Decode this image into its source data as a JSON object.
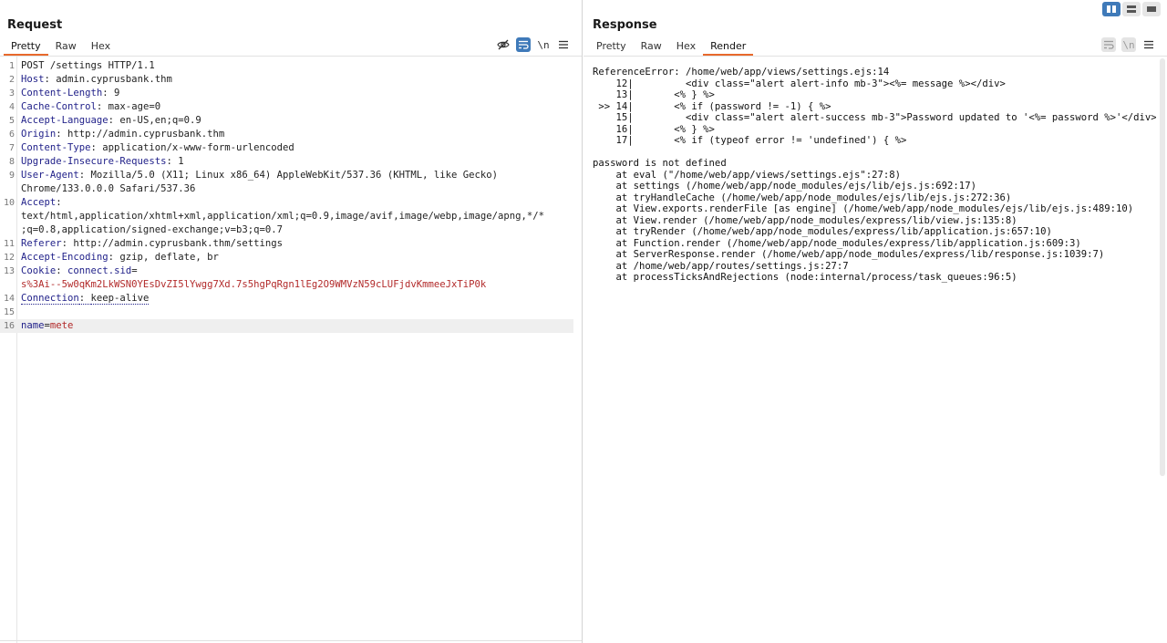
{
  "request": {
    "title": "Request",
    "tabs": [
      "Pretty",
      "Raw",
      "Hex"
    ],
    "active_tab": "Pretty",
    "toolbar_icons": [
      "eye-off-icon",
      "wrap-icon",
      "newline-icon",
      "menu-icon"
    ],
    "newline_label": "\\n",
    "lines": [
      {
        "n": "1",
        "parts": [
          {
            "t": "POST /settings HTTP/1.1",
            "c": ""
          }
        ]
      },
      {
        "n": "2",
        "parts": [
          {
            "t": "Host",
            "c": "kw"
          },
          {
            "t": ": admin.cyprusbank.thm",
            "c": ""
          }
        ]
      },
      {
        "n": "3",
        "parts": [
          {
            "t": "Content-Length",
            "c": "kw"
          },
          {
            "t": ": 9",
            "c": ""
          }
        ]
      },
      {
        "n": "4",
        "parts": [
          {
            "t": "Cache-Control",
            "c": "kw"
          },
          {
            "t": ": max-age=0",
            "c": ""
          }
        ]
      },
      {
        "n": "5",
        "parts": [
          {
            "t": "Accept-Language",
            "c": "kw"
          },
          {
            "t": ": en-US,en;q=0.9",
            "c": ""
          }
        ]
      },
      {
        "n": "6",
        "parts": [
          {
            "t": "Origin",
            "c": "kw"
          },
          {
            "t": ": http://admin.cyprusbank.thm",
            "c": ""
          }
        ]
      },
      {
        "n": "7",
        "parts": [
          {
            "t": "Content-Type",
            "c": "kw"
          },
          {
            "t": ": application/x-www-form-urlencoded",
            "c": ""
          }
        ]
      },
      {
        "n": "8",
        "parts": [
          {
            "t": "Upgrade-Insecure-Requests",
            "c": "kw"
          },
          {
            "t": ": 1",
            "c": ""
          }
        ]
      },
      {
        "n": "9",
        "parts": [
          {
            "t": "User-Agent",
            "c": "kw"
          },
          {
            "t": ": Mozilla/5.0 (X11; Linux x86_64) AppleWebKit/537.36 (KHTML, like Gecko)",
            "c": ""
          }
        ]
      },
      {
        "n": "",
        "parts": [
          {
            "t": "Chrome/133.0.0.0 Safari/537.36",
            "c": ""
          }
        ]
      },
      {
        "n": "10",
        "parts": [
          {
            "t": "Accept",
            "c": "kw"
          },
          {
            "t": ":",
            "c": ""
          }
        ]
      },
      {
        "n": "",
        "parts": [
          {
            "t": "text/html,application/xhtml+xml,application/xml;q=0.9,image/avif,image/webp,image/apng,*/*",
            "c": ""
          }
        ]
      },
      {
        "n": "",
        "parts": [
          {
            "t": ";q=0.8,application/signed-exchange;v=b3;q=0.7",
            "c": ""
          }
        ]
      },
      {
        "n": "11",
        "parts": [
          {
            "t": "Referer",
            "c": "kw"
          },
          {
            "t": ": http://admin.cyprusbank.thm/settings",
            "c": ""
          }
        ]
      },
      {
        "n": "12",
        "parts": [
          {
            "t": "Accept-Encoding",
            "c": "kw"
          },
          {
            "t": ": gzip, deflate, br",
            "c": ""
          }
        ]
      },
      {
        "n": "13",
        "parts": [
          {
            "t": "Cookie",
            "c": "kw"
          },
          {
            "t": ": ",
            "c": ""
          },
          {
            "t": "connect.sid",
            "c": "kw"
          },
          {
            "t": "=",
            "c": ""
          }
        ]
      },
      {
        "n": "",
        "parts": [
          {
            "t": "s%3Ai--5w0qKm2LkWSN0YEsDvZI5lYwgg7Xd.7s5hgPqRgn1lEg2O9WMVzN59cLUFjdvKmmeeJxTiP0k",
            "c": "red"
          }
        ]
      },
      {
        "n": "14",
        "parts": [
          {
            "t": "Connection",
            "c": "kw dot"
          },
          {
            "t": ": ",
            "c": "dot"
          },
          {
            "t": "keep-alive",
            "c": "dot"
          }
        ]
      },
      {
        "n": "15",
        "parts": [
          {
            "t": "",
            "c": ""
          }
        ]
      },
      {
        "n": "16",
        "hl": true,
        "parts": [
          {
            "t": "name",
            "c": "kw"
          },
          {
            "t": "=",
            "c": ""
          },
          {
            "t": "mete",
            "c": "red"
          }
        ]
      }
    ]
  },
  "response": {
    "title": "Response",
    "tabs": [
      "Pretty",
      "Raw",
      "Hex",
      "Render"
    ],
    "active_tab": "Render",
    "toolbar_icons": [
      "wrap-icon",
      "newline-icon",
      "menu-icon"
    ],
    "newline_label": "\\n",
    "render_text": "ReferenceError: /home/web/app/views/settings.ejs:14\n    12|         <div class=\"alert alert-info mb-3\"><%= message %></div>\n    13|       <% } %>\n >> 14|       <% if (password != -1) { %>\n    15|         <div class=\"alert alert-success mb-3\">Password updated to '<%= password %>'</div>\n    16|       <% } %>\n    17|       <% if (typeof error != 'undefined') { %>\n\npassword is not defined\n    at eval (\"/home/web/app/views/settings.ejs\":27:8)\n    at settings (/home/web/app/node_modules/ejs/lib/ejs.js:692:17)\n    at tryHandleCache (/home/web/app/node_modules/ejs/lib/ejs.js:272:36)\n    at View.exports.renderFile [as engine] (/home/web/app/node_modules/ejs/lib/ejs.js:489:10)\n    at View.render (/home/web/app/node_modules/express/lib/view.js:135:8)\n    at tryRender (/home/web/app/node_modules/express/lib/application.js:657:10)\n    at Function.render (/home/web/app/node_modules/express/lib/application.js:609:3)\n    at ServerResponse.render (/home/web/app/node_modules/express/lib/response.js:1039:7)\n    at /home/web/app/routes/settings.js:27:7\n    at processTicksAndRejections (node:internal/process/task_queues:96:5)"
  },
  "layout_toggle": {
    "buttons": [
      "split-horizontal-icon",
      "split-vertical-icon",
      "single-pane-icon"
    ],
    "active": "split-horizontal-icon"
  },
  "colors": {
    "accent": "#e8692c",
    "toggle_on": "#3f7ab9",
    "header_key": "#22228a",
    "value_red": "#b22a2a"
  }
}
